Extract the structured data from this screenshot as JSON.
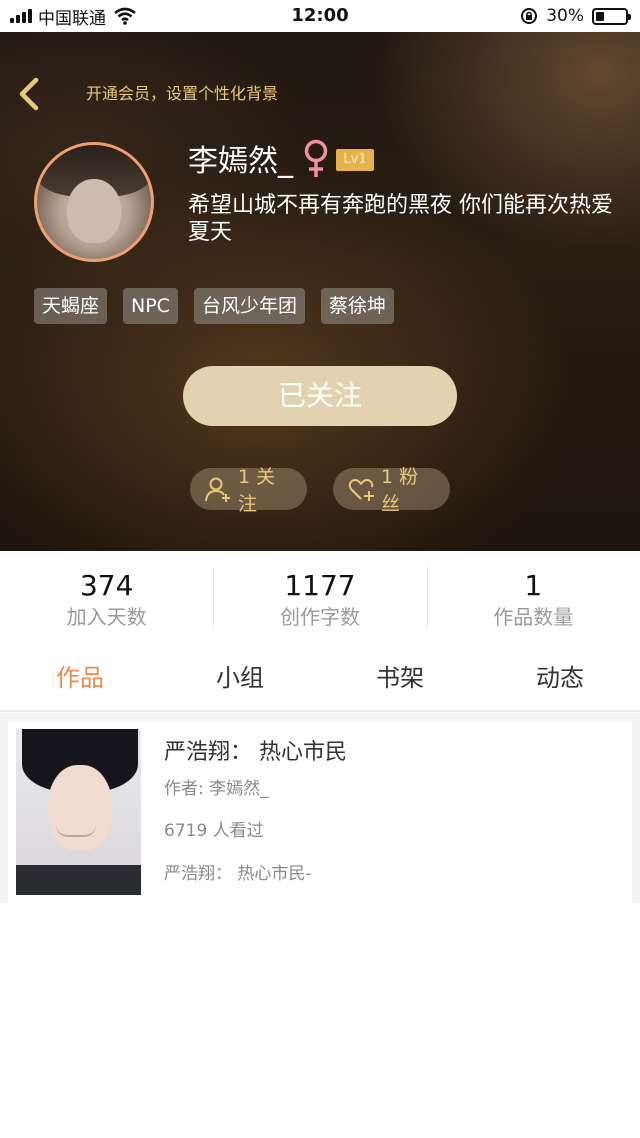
{
  "status_bar": {
    "carrier": "中国联通",
    "time": "12:00",
    "battery_text": "30%",
    "battery_level": 0.3
  },
  "header": {
    "back_icon": "chevron-left-icon",
    "custom_bg_text": "开通会员，设置个性化背景",
    "accent_color": "#e9c977"
  },
  "profile": {
    "username": "李嫣然_",
    "gender_icon": "female-icon",
    "level": "Lv1",
    "bio": "希望山城不再有奔跑的黑夜 你们能再次热爱夏天",
    "tags": [
      "天蝎座",
      "NPC",
      "台风少年团",
      "蔡徐坤"
    ],
    "follow_button": "已关注",
    "following_text": "1 关注",
    "fans_text": "1 粉丝"
  },
  "stats": [
    {
      "value": "374",
      "label": "加入天数"
    },
    {
      "value": "1177",
      "label": "创作字数"
    },
    {
      "value": "1",
      "label": "作品数量"
    }
  ],
  "tabs": [
    {
      "label": "作品",
      "active": true
    },
    {
      "label": "小组",
      "active": false
    },
    {
      "label": "书架",
      "active": false
    },
    {
      "label": "动态",
      "active": false
    }
  ],
  "works": [
    {
      "title": "严浩翔：  热心市民",
      "author": "作者: 李嫣然_",
      "views": "6719 人看过",
      "latest": "严浩翔：  热心市民-"
    }
  ],
  "colors": {
    "active_tab": "#e98a4e",
    "follow_button_bg": "#e2d2af",
    "level_badge": "#e8b14a",
    "avatar_border": "#f0a070"
  }
}
